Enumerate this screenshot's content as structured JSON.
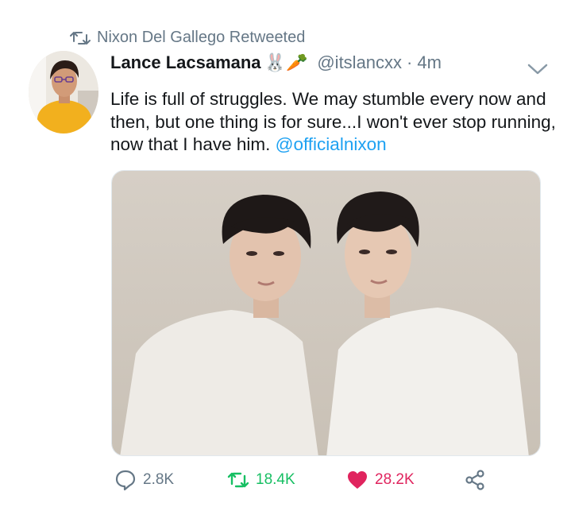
{
  "retweet_context": {
    "text": "Nixon Del Gallego Retweeted",
    "icon": "retweet-icon"
  },
  "tweet": {
    "author_name": "Lance Lacsamana",
    "author_emoji": "🐰🥕",
    "handle": "@itslancxx",
    "separator": "·",
    "time": "4m",
    "text": "Life is full of struggles. We may stumble every now and then, but one thing is for sure...I won't ever stop running, now that I have him. ",
    "mention": "@officialnixon"
  },
  "actions": {
    "replies": "2.8K",
    "retweets": "18.4K",
    "likes": "28.2K"
  },
  "colors": {
    "accent": "#1da1f2",
    "retweet_green": "#17bf63",
    "like_red": "#e0245e",
    "muted": "#657786"
  }
}
